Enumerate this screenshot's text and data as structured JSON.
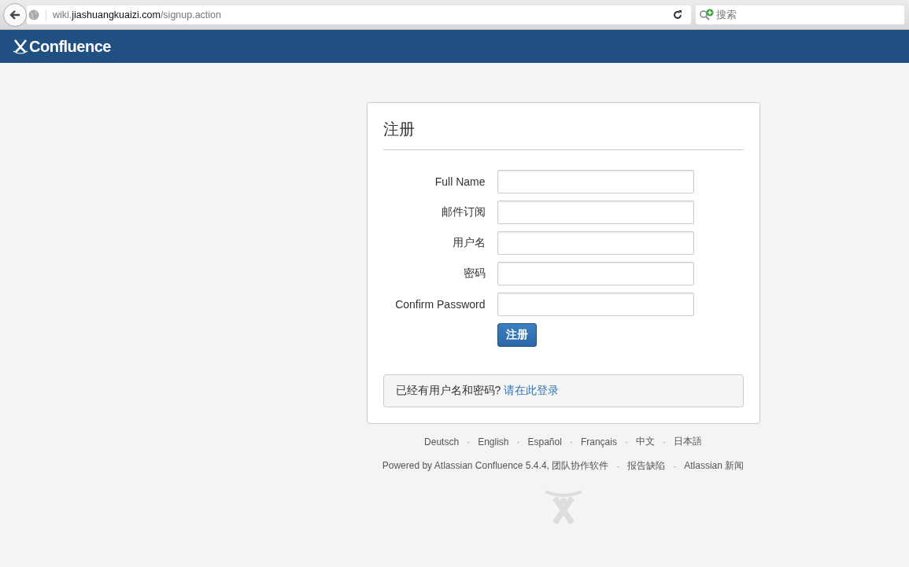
{
  "browser": {
    "url": [
      {
        "kind": "dim",
        "text": "wiki."
      },
      {
        "kind": "host",
        "text": "jiashuangkuaizi.com"
      },
      {
        "kind": "dim",
        "text": "/signup.action"
      }
    ],
    "search": {
      "placeholder": "搜索"
    }
  },
  "header": {
    "product": "Confluence"
  },
  "form": {
    "title": "注册",
    "fields": [
      {
        "label": "Full Name"
      },
      {
        "label": "邮件订阅"
      },
      {
        "label": "用户名"
      },
      {
        "label": "密码"
      },
      {
        "label": "Confirm Password"
      }
    ],
    "submit": "注册",
    "login_prompt": "已经有用户名和密码?",
    "login_link": "请在此登录"
  },
  "footer": {
    "languages": [
      "Deutsch",
      "English",
      "Español",
      "Français",
      "中文",
      "日本語"
    ],
    "separator": "·",
    "links": [
      "Powered by Atlassian Confluence 5.4.4, 团队协作软件",
      "报告缺陷",
      "Atlassian 新闻"
    ]
  }
}
